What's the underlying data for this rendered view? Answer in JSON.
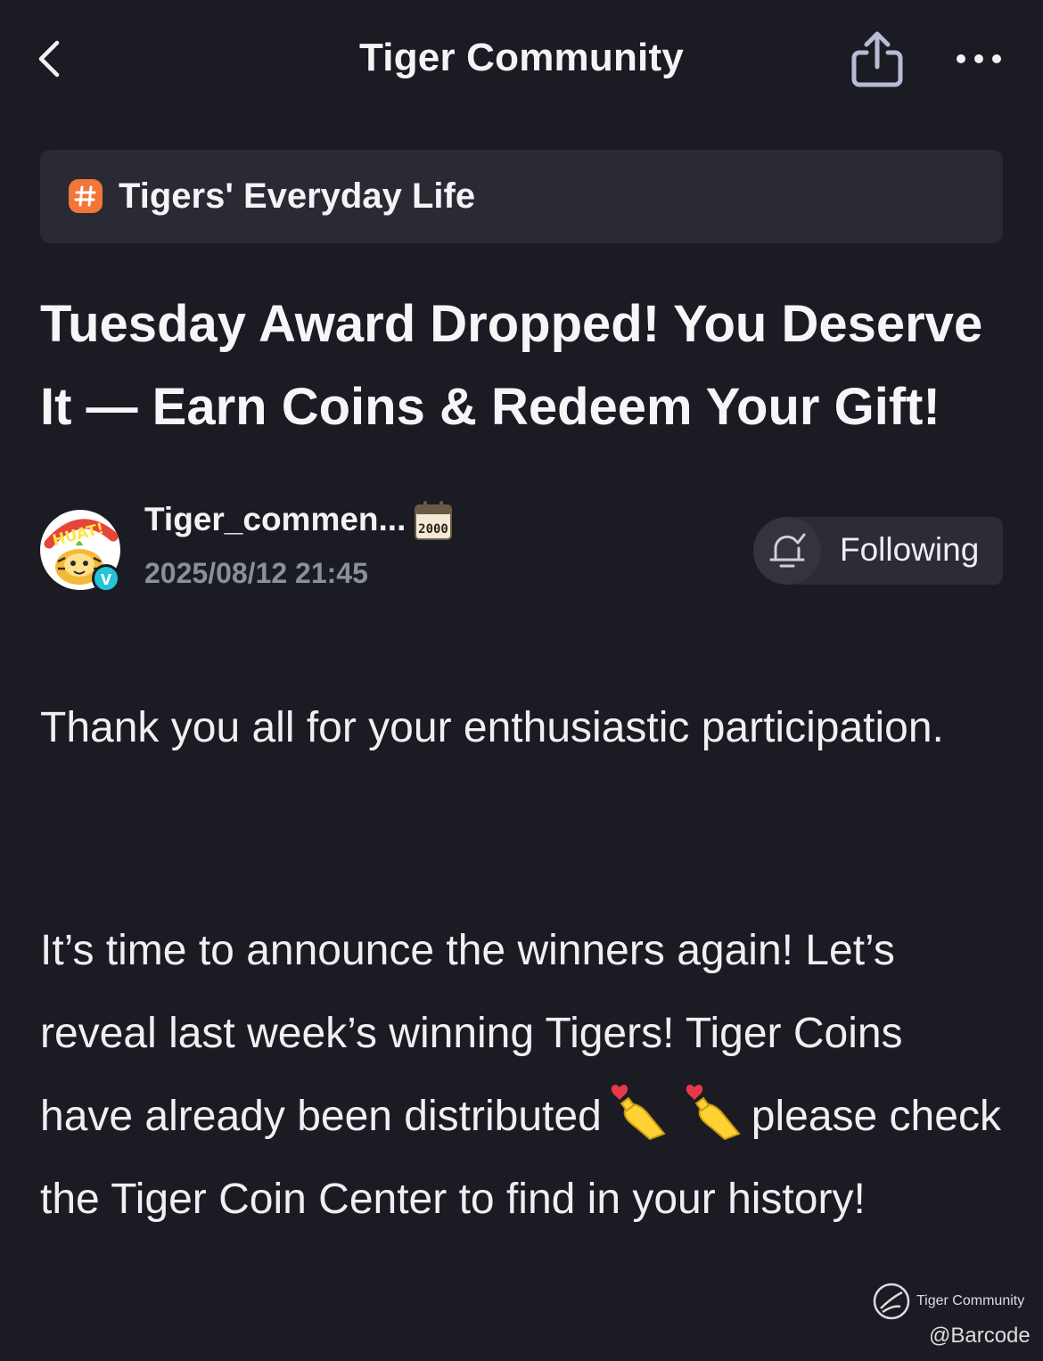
{
  "header": {
    "title": "Tiger Community",
    "back_icon": "chevron-left-icon",
    "share_icon": "share-icon",
    "more_icon": "more-horizontal-icon"
  },
  "topic": {
    "label": "Tigers' Everyday Life",
    "badge_symbol": "#",
    "badge_color": "#f2753a"
  },
  "post": {
    "title": "Tuesday Award Dropped! You Deserve It — Earn Coins & Redeem Your Gift!",
    "author": {
      "name": "Tiger_commen...",
      "timestamp": "2025/08/12 21:45",
      "avatar_text": "HUAT!",
      "verified_badge": "v",
      "rank_badge": "2000"
    },
    "follow": {
      "label": "Following",
      "bell_icon": "bell-check-icon"
    },
    "paragraphs": {
      "p1": "Thank you all for your enthusiastic participation.",
      "p2_part1": "It’s time to announce the winners again! Let’s reveal last week’s winning Tigers! Tiger Coins have already been distributed",
      "p2_part2": "please check the Tiger Coin Center to find in your history!"
    },
    "emojis": [
      "finger-heart-icon",
      "finger-heart-icon"
    ]
  },
  "watermark": {
    "brand": "Tiger Community",
    "user": "@Barcode"
  },
  "colors": {
    "background": "#1b1b23",
    "card": "#292a33",
    "text": "#f2f2f4",
    "muted": "#8c8e9c",
    "verified": "#26c2d6"
  }
}
